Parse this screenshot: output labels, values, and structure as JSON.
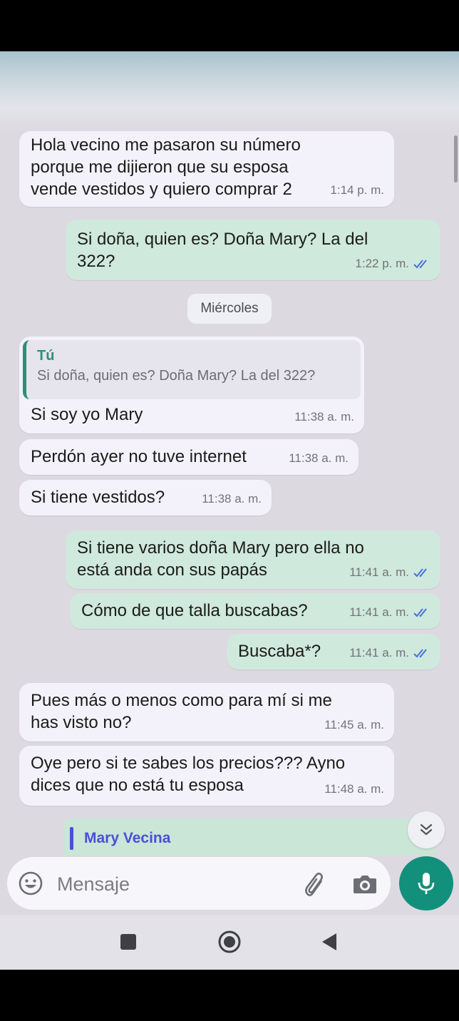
{
  "chat": {
    "messages": [
      {
        "dir": "in",
        "text": "Hola vecino me pasaron su número porque me dijieron que su esposa vende vestidos y quiero comprar 2",
        "time": "1:14 p. m."
      },
      {
        "dir": "out",
        "text": "Si doña, quien es? Doña Mary? La del 322?",
        "time": "1:22 p. m."
      },
      {
        "dir": "in",
        "quote_name": "Tú",
        "quote_text": "Si doña, quien es? Doña Mary? La del 322?",
        "text": "Si soy yo Mary",
        "time": "11:38 a. m."
      },
      {
        "dir": "in",
        "text": "Perdón ayer no tuve internet",
        "time": "11:38 a. m."
      },
      {
        "dir": "in",
        "text": "Si tiene vestidos?",
        "time": "11:38 a. m."
      },
      {
        "dir": "out",
        "text": "Si tiene varios doña Mary pero ella no está anda con sus papás",
        "time": "11:41 a. m."
      },
      {
        "dir": "out",
        "text": "Cómo de que talla buscabas?",
        "time": "11:41 a. m."
      },
      {
        "dir": "out",
        "text": "Buscaba*?",
        "time": "11:41 a. m."
      },
      {
        "dir": "in",
        "text": "Pues más o menos como para mí si me has visto no?",
        "time": "11:45 a. m."
      },
      {
        "dir": "in",
        "text": "Oye pero si te sabes los precios??? Ayno dices que no está tu esposa",
        "time": "11:48 a. m."
      }
    ],
    "day_separator": "Miércoles",
    "reply_preview_name": "Mary Vecina"
  },
  "composer": {
    "placeholder": "Mensaje"
  },
  "icons": {
    "emoji": "emoji-icon",
    "attach": "paperclip-icon",
    "camera": "camera-icon",
    "mic": "microphone-icon",
    "scroll_down": "double-chevron-down-icon",
    "read_receipt": "double-check-icon",
    "nav": [
      "square-icon",
      "circle-icon",
      "triangle-back-icon"
    ]
  },
  "colors": {
    "incoming_bubble": "#f3f2fa",
    "outgoing_bubble": "#cfe9dc",
    "accent_green": "#12907b",
    "read_ticks": "#4b6fe0",
    "quote_name": "#2f8f72",
    "reply_name": "#4b4fd6"
  }
}
